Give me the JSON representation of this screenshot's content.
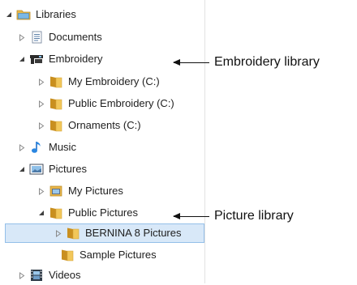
{
  "tree": {
    "items": [
      {
        "label": "Libraries",
        "icon": "library-folder-icon",
        "expander": "expanded"
      },
      {
        "label": "Documents",
        "icon": "documents-icon",
        "expander": "collapsed"
      },
      {
        "label": "Embroidery",
        "icon": "embroidery-library-icon",
        "expander": "expanded"
      },
      {
        "label": "My Embroidery (C:)",
        "icon": "folder-icon",
        "expander": "collapsed"
      },
      {
        "label": "Public Embroidery (C:)",
        "icon": "folder-icon",
        "expander": "collapsed"
      },
      {
        "label": "Ornaments (C:)",
        "icon": "folder-icon",
        "expander": "collapsed"
      },
      {
        "label": "Music",
        "icon": "music-icon",
        "expander": "collapsed"
      },
      {
        "label": "Pictures",
        "icon": "pictures-library-icon",
        "expander": "expanded"
      },
      {
        "label": "My Pictures",
        "icon": "my-pictures-icon",
        "expander": "collapsed"
      },
      {
        "label": "Public Pictures",
        "icon": "folder-icon",
        "expander": "expanded"
      },
      {
        "label": "BERNINA 8 Pictures",
        "icon": "folder-icon",
        "expander": "collapsed",
        "selected": true
      },
      {
        "label": "Sample Pictures",
        "icon": "folder-icon",
        "expander": "none"
      },
      {
        "label": "Videos",
        "icon": "videos-icon",
        "expander": "collapsed"
      }
    ]
  },
  "annotations": {
    "embroidery": "Embroidery library",
    "pictures": "Picture library"
  },
  "colors": {
    "selection_bg": "#d8e8f8",
    "selection_border": "#94bfe9",
    "folder": "#e8b54a"
  }
}
